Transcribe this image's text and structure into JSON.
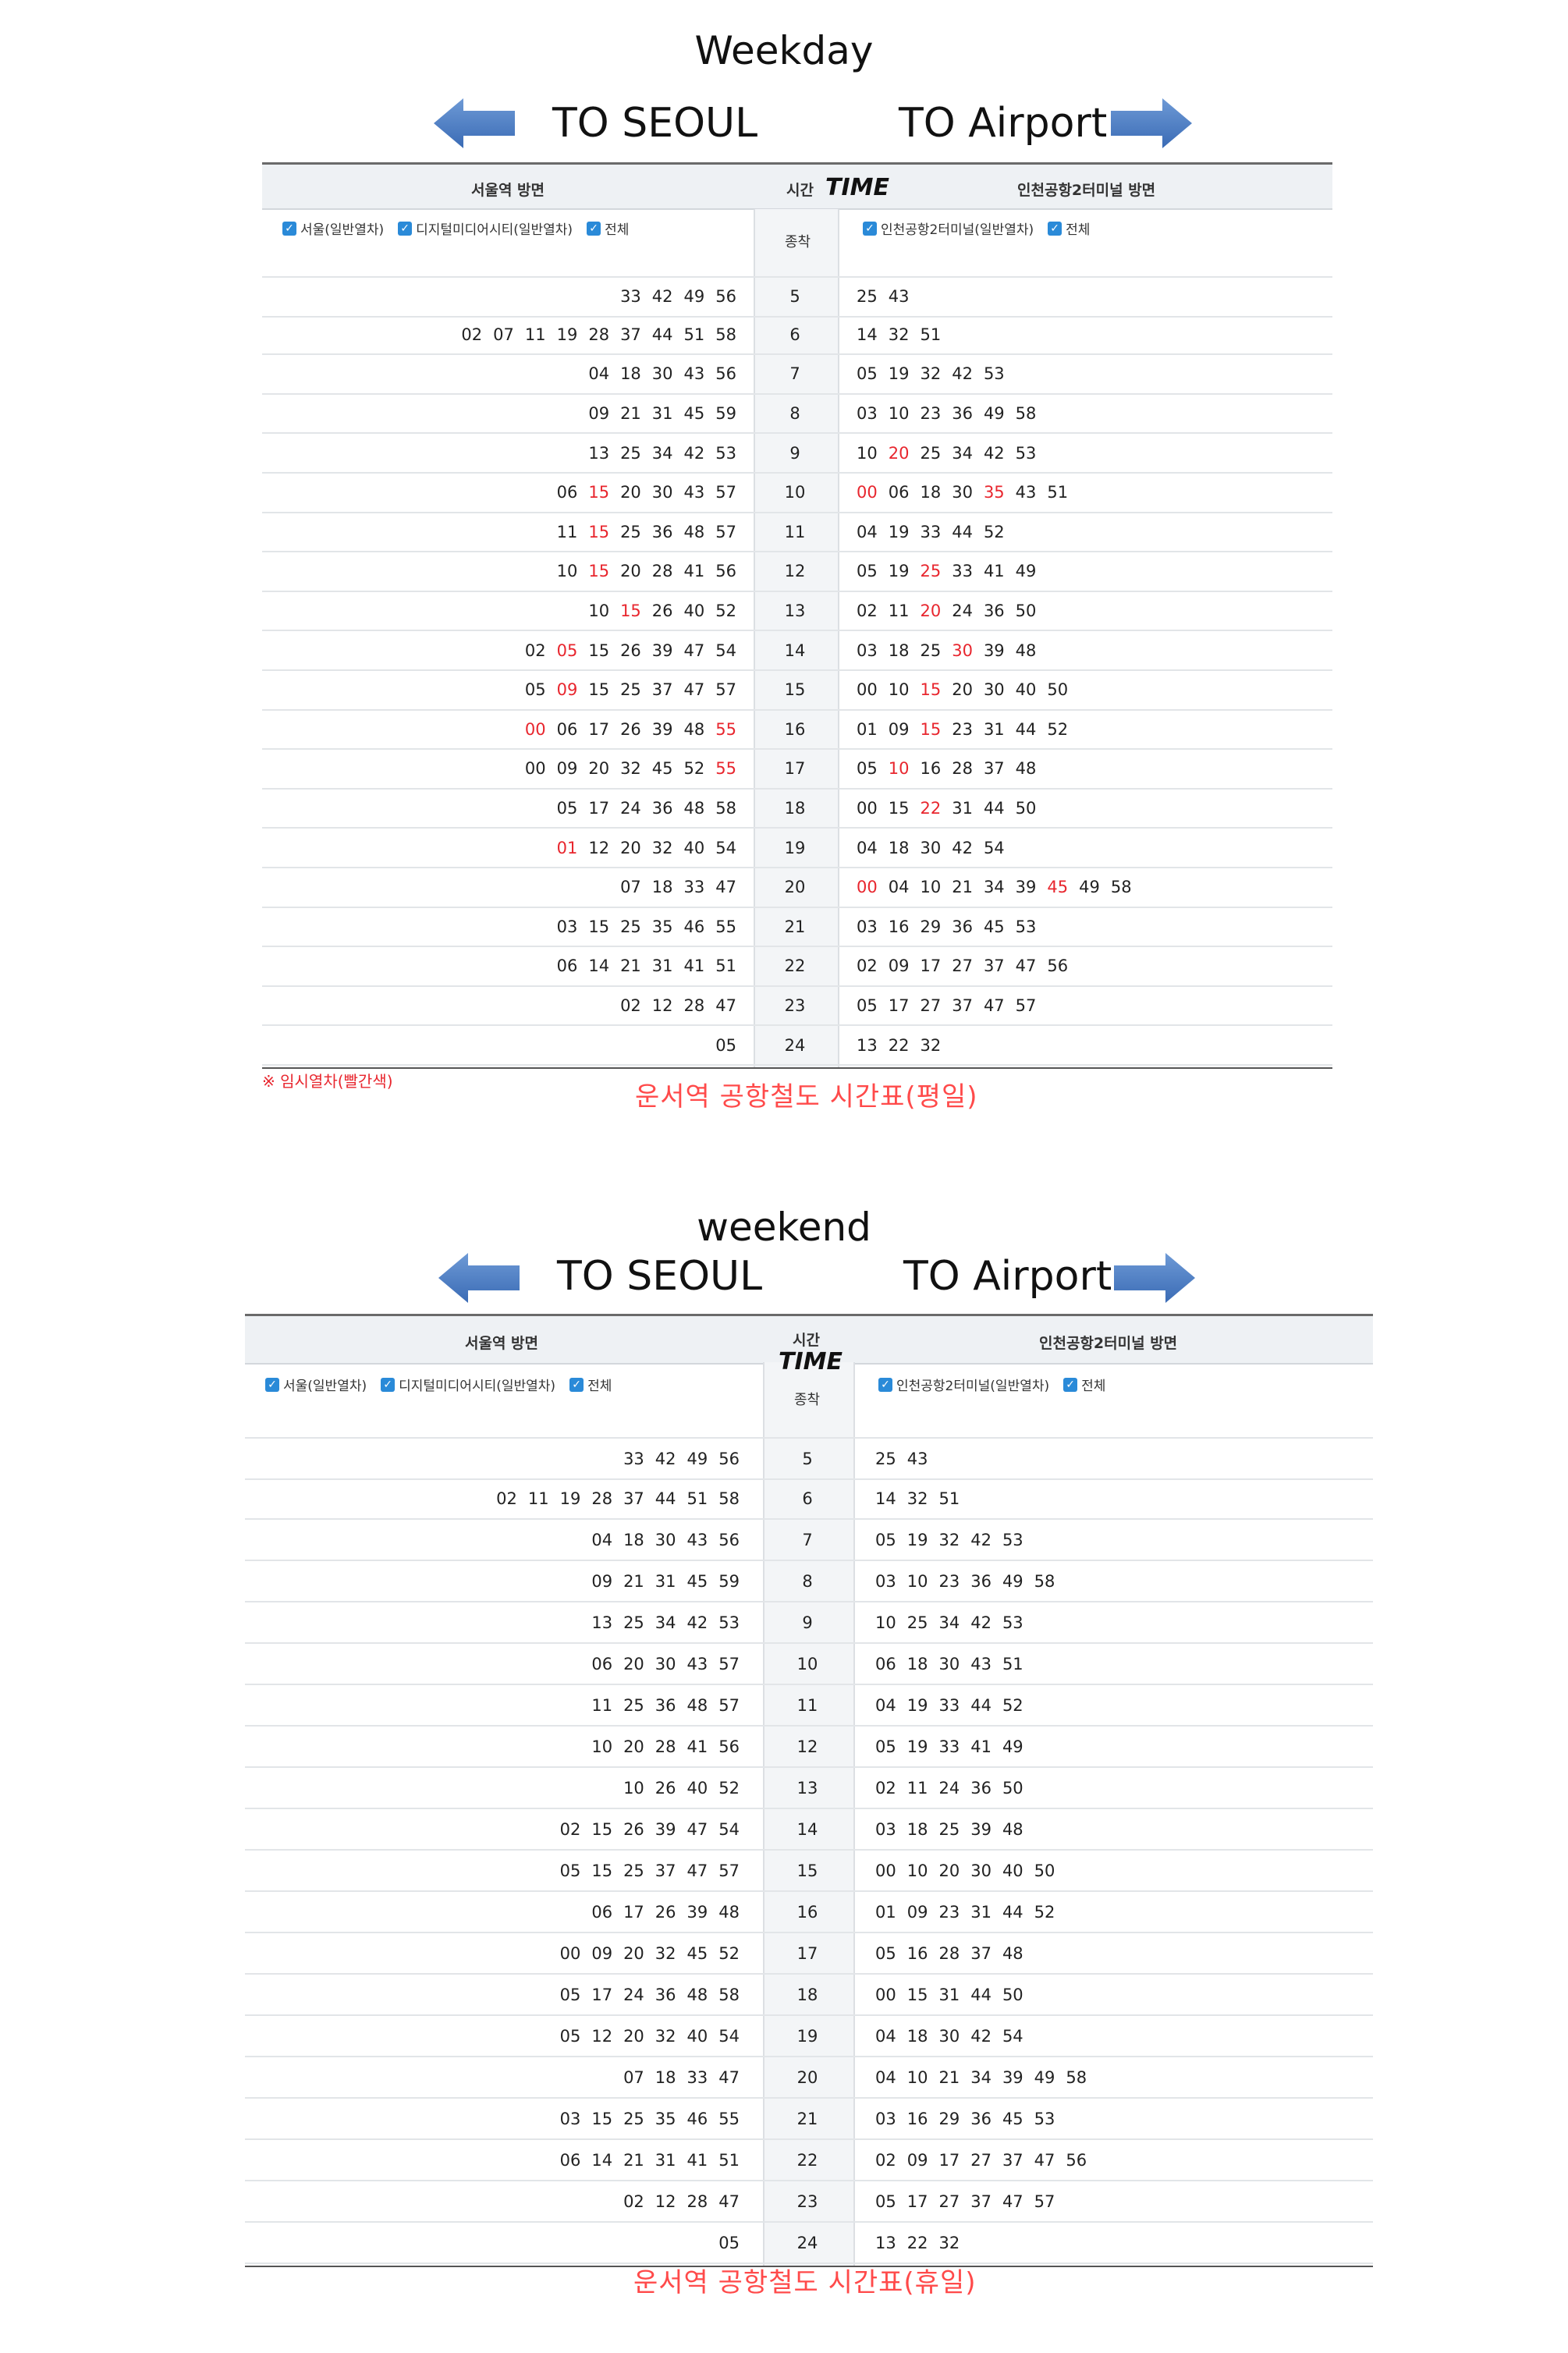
{
  "weekday": {
    "heading": "Weekday",
    "to_seoul": "TO SEOUL",
    "to_airport": "TO Airport",
    "hdr_left": "서울역 방면",
    "hdr_time_ko": "시간",
    "hdr_time_en": "TIME",
    "hdr_right": "인천공항2터미널 방면",
    "hdr_mid_sub": "종착",
    "filter_left": [
      "서울(일반열차)",
      "디지털미디어시티(일반열차)",
      "전체"
    ],
    "filter_right": [
      "인천공항2터미널(일반열차)",
      "전체"
    ],
    "note": "※ 임시열차(빨간색)",
    "caption": "운서역 공항철도 시간표(평일)",
    "rows": [
      {
        "hour": "5",
        "seoul": [
          "33",
          "42",
          "49",
          "56"
        ],
        "seoul_red": [],
        "airport": [
          "25",
          "43"
        ],
        "airport_red": []
      },
      {
        "hour": "6",
        "seoul": [
          "02",
          "07",
          "11",
          "19",
          "28",
          "37",
          "44",
          "51",
          "58"
        ],
        "seoul_red": [],
        "airport": [
          "14",
          "32",
          "51"
        ],
        "airport_red": []
      },
      {
        "hour": "7",
        "seoul": [
          "04",
          "18",
          "30",
          "43",
          "56"
        ],
        "seoul_red": [],
        "airport": [
          "05",
          "19",
          "32",
          "42",
          "53"
        ],
        "airport_red": []
      },
      {
        "hour": "8",
        "seoul": [
          "09",
          "21",
          "31",
          "45",
          "59"
        ],
        "seoul_red": [],
        "airport": [
          "03",
          "10",
          "23",
          "36",
          "49",
          "58"
        ],
        "airport_red": []
      },
      {
        "hour": "9",
        "seoul": [
          "13",
          "25",
          "34",
          "42",
          "53"
        ],
        "seoul_red": [],
        "airport": [
          "10",
          "20",
          "25",
          "34",
          "42",
          "53"
        ],
        "airport_red": [
          "20"
        ]
      },
      {
        "hour": "10",
        "seoul": [
          "06",
          "15",
          "20",
          "30",
          "43",
          "57"
        ],
        "seoul_red": [
          "15"
        ],
        "airport": [
          "00",
          "06",
          "18",
          "30",
          "35",
          "43",
          "51"
        ],
        "airport_red": [
          "00",
          "35"
        ]
      },
      {
        "hour": "11",
        "seoul": [
          "11",
          "15",
          "25",
          "36",
          "48",
          "57"
        ],
        "seoul_red": [
          "15"
        ],
        "airport": [
          "04",
          "19",
          "33",
          "44",
          "52"
        ],
        "airport_red": []
      },
      {
        "hour": "12",
        "seoul": [
          "10",
          "15",
          "20",
          "28",
          "41",
          "56"
        ],
        "seoul_red": [
          "15"
        ],
        "airport": [
          "05",
          "19",
          "25",
          "33",
          "41",
          "49"
        ],
        "airport_red": [
          "25"
        ]
      },
      {
        "hour": "13",
        "seoul": [
          "10",
          "15",
          "26",
          "40",
          "52"
        ],
        "seoul_red": [
          "15"
        ],
        "airport": [
          "02",
          "11",
          "20",
          "24",
          "36",
          "50"
        ],
        "airport_red": [
          "20"
        ]
      },
      {
        "hour": "14",
        "seoul": [
          "02",
          "05",
          "15",
          "26",
          "39",
          "47",
          "54"
        ],
        "seoul_red": [
          "05"
        ],
        "airport": [
          "03",
          "18",
          "25",
          "30",
          "39",
          "48"
        ],
        "airport_red": [
          "30"
        ]
      },
      {
        "hour": "15",
        "seoul": [
          "05",
          "09",
          "15",
          "25",
          "37",
          "47",
          "57"
        ],
        "seoul_red": [
          "09"
        ],
        "airport": [
          "00",
          "10",
          "15",
          "20",
          "30",
          "40",
          "50"
        ],
        "airport_red": [
          "15"
        ]
      },
      {
        "hour": "16",
        "seoul": [
          "00",
          "06",
          "17",
          "26",
          "39",
          "48",
          "55"
        ],
        "seoul_red": [
          "00",
          "55"
        ],
        "airport": [
          "01",
          "09",
          "15",
          "23",
          "31",
          "44",
          "52"
        ],
        "airport_red": [
          "15"
        ]
      },
      {
        "hour": "17",
        "seoul": [
          "00",
          "09",
          "20",
          "32",
          "45",
          "52",
          "55"
        ],
        "seoul_red": [
          "55"
        ],
        "airport": [
          "05",
          "10",
          "16",
          "28",
          "37",
          "48"
        ],
        "airport_red": [
          "10"
        ]
      },
      {
        "hour": "18",
        "seoul": [
          "05",
          "17",
          "24",
          "36",
          "48",
          "58"
        ],
        "seoul_red": [],
        "airport": [
          "00",
          "15",
          "22",
          "31",
          "44",
          "50"
        ],
        "airport_red": [
          "22"
        ]
      },
      {
        "hour": "19",
        "seoul": [
          "01",
          "12",
          "20",
          "32",
          "40",
          "54"
        ],
        "seoul_red": [
          "01"
        ],
        "airport": [
          "04",
          "18",
          "30",
          "42",
          "54"
        ],
        "airport_red": []
      },
      {
        "hour": "20",
        "seoul": [
          "07",
          "18",
          "33",
          "47"
        ],
        "seoul_red": [],
        "airport": [
          "00",
          "04",
          "10",
          "21",
          "34",
          "39",
          "45",
          "49",
          "58"
        ],
        "airport_red": [
          "00",
          "45"
        ]
      },
      {
        "hour": "21",
        "seoul": [
          "03",
          "15",
          "25",
          "35",
          "46",
          "55"
        ],
        "seoul_red": [],
        "airport": [
          "03",
          "16",
          "29",
          "36",
          "45",
          "53"
        ],
        "airport_red": []
      },
      {
        "hour": "22",
        "seoul": [
          "06",
          "14",
          "21",
          "31",
          "41",
          "51"
        ],
        "seoul_red": [],
        "airport": [
          "02",
          "09",
          "17",
          "27",
          "37",
          "47",
          "56"
        ],
        "airport_red": []
      },
      {
        "hour": "23",
        "seoul": [
          "02",
          "12",
          "28",
          "47"
        ],
        "seoul_red": [],
        "airport": [
          "05",
          "17",
          "27",
          "37",
          "47",
          "57"
        ],
        "airport_red": []
      },
      {
        "hour": "24",
        "seoul": [
          "05"
        ],
        "seoul_red": [],
        "airport": [
          "13",
          "22",
          "32"
        ],
        "airport_red": []
      }
    ]
  },
  "weekend": {
    "heading": "weekend",
    "to_seoul": "TO SEOUL",
    "to_airport": "TO Airport",
    "hdr_left": "서울역 방면",
    "hdr_time_ko": "시간",
    "hdr_time_en": "TIME",
    "hdr_right": "인천공항2터미널 방면",
    "hdr_mid_sub": "종착",
    "filter_left": [
      "서울(일반열차)",
      "디지털미디어시티(일반열차)",
      "전체"
    ],
    "filter_right": [
      "인천공항2터미널(일반열차)",
      "전체"
    ],
    "caption": "운서역 공항철도 시간표(휴일)",
    "rows": [
      {
        "hour": "5",
        "seoul": [
          "33",
          "42",
          "49",
          "56"
        ],
        "airport": [
          "25",
          "43"
        ]
      },
      {
        "hour": "6",
        "seoul": [
          "02",
          "11",
          "19",
          "28",
          "37",
          "44",
          "51",
          "58"
        ],
        "airport": [
          "14",
          "32",
          "51"
        ]
      },
      {
        "hour": "7",
        "seoul": [
          "04",
          "18",
          "30",
          "43",
          "56"
        ],
        "airport": [
          "05",
          "19",
          "32",
          "42",
          "53"
        ]
      },
      {
        "hour": "8",
        "seoul": [
          "09",
          "21",
          "31",
          "45",
          "59"
        ],
        "airport": [
          "03",
          "10",
          "23",
          "36",
          "49",
          "58"
        ]
      },
      {
        "hour": "9",
        "seoul": [
          "13",
          "25",
          "34",
          "42",
          "53"
        ],
        "airport": [
          "10",
          "25",
          "34",
          "42",
          "53"
        ]
      },
      {
        "hour": "10",
        "seoul": [
          "06",
          "20",
          "30",
          "43",
          "57"
        ],
        "airport": [
          "06",
          "18",
          "30",
          "43",
          "51"
        ]
      },
      {
        "hour": "11",
        "seoul": [
          "11",
          "25",
          "36",
          "48",
          "57"
        ],
        "airport": [
          "04",
          "19",
          "33",
          "44",
          "52"
        ]
      },
      {
        "hour": "12",
        "seoul": [
          "10",
          "20",
          "28",
          "41",
          "56"
        ],
        "airport": [
          "05",
          "19",
          "33",
          "41",
          "49"
        ]
      },
      {
        "hour": "13",
        "seoul": [
          "10",
          "26",
          "40",
          "52"
        ],
        "airport": [
          "02",
          "11",
          "24",
          "36",
          "50"
        ]
      },
      {
        "hour": "14",
        "seoul": [
          "02",
          "15",
          "26",
          "39",
          "47",
          "54"
        ],
        "airport": [
          "03",
          "18",
          "25",
          "39",
          "48"
        ]
      },
      {
        "hour": "15",
        "seoul": [
          "05",
          "15",
          "25",
          "37",
          "47",
          "57"
        ],
        "airport": [
          "00",
          "10",
          "20",
          "30",
          "40",
          "50"
        ]
      },
      {
        "hour": "16",
        "seoul": [
          "06",
          "17",
          "26",
          "39",
          "48"
        ],
        "airport": [
          "01",
          "09",
          "23",
          "31",
          "44",
          "52"
        ]
      },
      {
        "hour": "17",
        "seoul": [
          "00",
          "09",
          "20",
          "32",
          "45",
          "52"
        ],
        "airport": [
          "05",
          "16",
          "28",
          "37",
          "48"
        ]
      },
      {
        "hour": "18",
        "seoul": [
          "05",
          "17",
          "24",
          "36",
          "48",
          "58"
        ],
        "airport": [
          "00",
          "15",
          "31",
          "44",
          "50"
        ]
      },
      {
        "hour": "19",
        "seoul": [
          "05",
          "12",
          "20",
          "32",
          "40",
          "54"
        ],
        "airport": [
          "04",
          "18",
          "30",
          "42",
          "54"
        ]
      },
      {
        "hour": "20",
        "seoul": [
          "07",
          "18",
          "33",
          "47"
        ],
        "airport": [
          "04",
          "10",
          "21",
          "34",
          "39",
          "49",
          "58"
        ]
      },
      {
        "hour": "21",
        "seoul": [
          "03",
          "15",
          "25",
          "35",
          "46",
          "55"
        ],
        "airport": [
          "03",
          "16",
          "29",
          "36",
          "45",
          "53"
        ]
      },
      {
        "hour": "22",
        "seoul": [
          "06",
          "14",
          "21",
          "31",
          "41",
          "51"
        ],
        "airport": [
          "02",
          "09",
          "17",
          "27",
          "37",
          "47",
          "56"
        ]
      },
      {
        "hour": "23",
        "seoul": [
          "02",
          "12",
          "28",
          "47"
        ],
        "airport": [
          "05",
          "17",
          "27",
          "37",
          "47",
          "57"
        ]
      },
      {
        "hour": "24",
        "seoul": [
          "05"
        ],
        "airport": [
          "13",
          "22",
          "32"
        ]
      }
    ]
  },
  "colors": {
    "arrow": "#4a7bc4",
    "temporary_train": "#e8262e",
    "caption": "#ff4a4a"
  },
  "icons": {
    "left_arrow": "arrow-left-icon",
    "right_arrow": "arrow-right-icon",
    "checkbox": "checkbox-checked-icon"
  }
}
